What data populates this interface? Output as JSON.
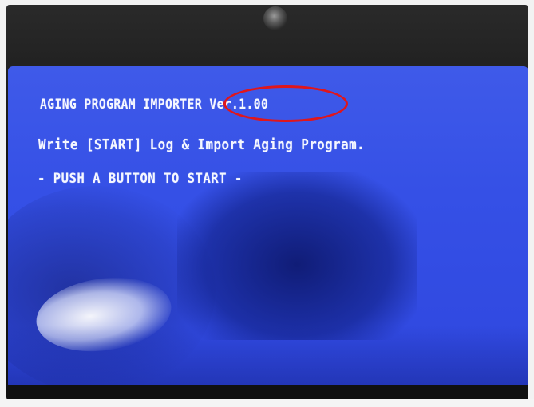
{
  "screen": {
    "line1": "AGING PROGRAM IMPORTER Ver.1.00",
    "line2": "Write [START] Log & Import Aging Program.",
    "line3": "- PUSH A BUTTON TO START -"
  },
  "annotation": {
    "highlight_color": "#e0161b"
  },
  "colors": {
    "screen_blue": "#3550e6",
    "text": "#f5f7ff"
  }
}
